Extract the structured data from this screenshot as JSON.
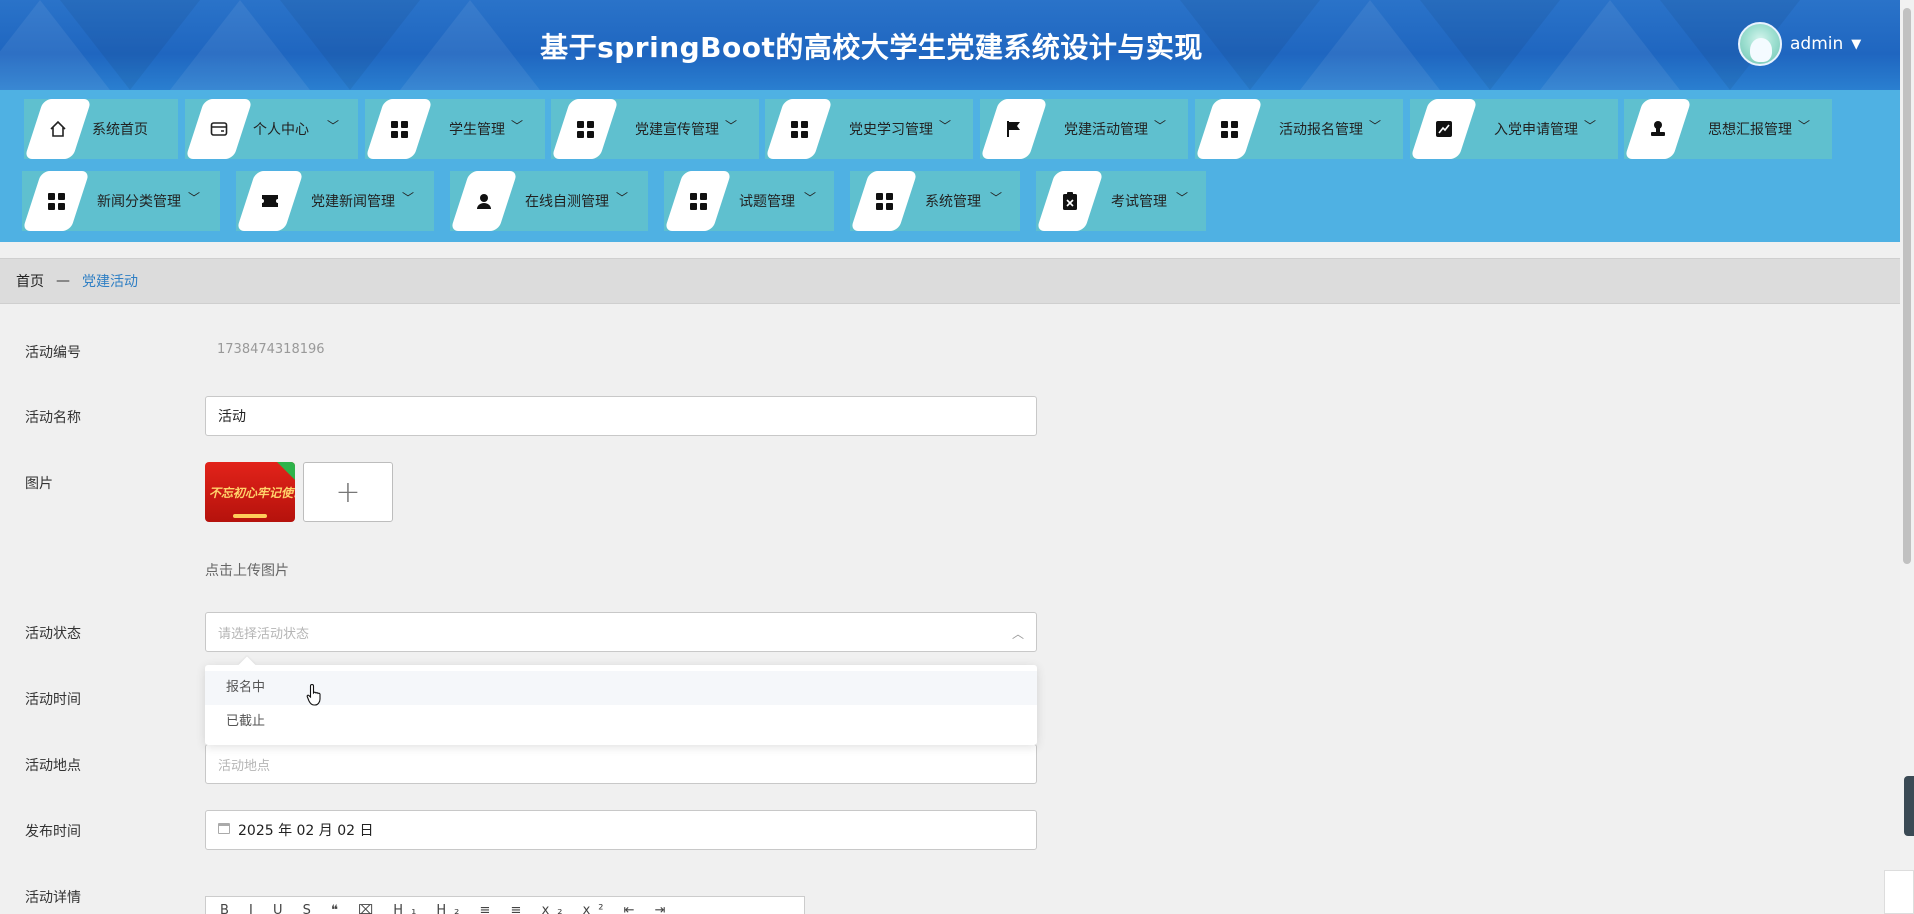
{
  "header": {
    "title": "基于springBoot的高校大学生党建系统设计与实现",
    "user": "admin"
  },
  "nav": {
    "items": [
      {
        "label": "系统首页",
        "icon": "home-icon"
      },
      {
        "label": "个人中心",
        "icon": "card-icon"
      },
      {
        "label": "学生管理",
        "icon": "grid-icon"
      },
      {
        "label": "党建宣传管理",
        "icon": "grid-icon"
      },
      {
        "label": "党史学习管理",
        "icon": "grid-icon"
      },
      {
        "label": "党建活动管理",
        "icon": "flag-icon"
      },
      {
        "label": "活动报名管理",
        "icon": "grid-icon"
      },
      {
        "label": "入党申请管理",
        "icon": "chart-icon"
      },
      {
        "label": "思想汇报管理",
        "icon": "stamp-icon"
      },
      {
        "label": "新闻分类管理",
        "icon": "grid-icon"
      },
      {
        "label": "党建新闻管理",
        "icon": "ticket-icon"
      },
      {
        "label": "在线自测管理",
        "icon": "user-icon"
      },
      {
        "label": "试题管理",
        "icon": "grid-icon"
      },
      {
        "label": "系统管理",
        "icon": "grid-icon"
      },
      {
        "label": "考试管理",
        "icon": "clipboard-icon"
      }
    ]
  },
  "breadcrumb": {
    "home": "首页",
    "separator": "—",
    "current": "党建活动"
  },
  "form": {
    "activity_no": {
      "label": "活动编号",
      "value": "1738474318196"
    },
    "activity_name": {
      "label": "活动名称",
      "value": "活动"
    },
    "image": {
      "label": "图片",
      "thumb_text": "不忘初心牢记使命",
      "upload_symbol": "+",
      "hint": "点击上传图片"
    },
    "status": {
      "label": "活动状态",
      "placeholder": "请选择活动状态",
      "options": [
        "报名中",
        "已截止"
      ]
    },
    "time": {
      "label": "活动时间"
    },
    "location": {
      "label": "活动地点",
      "placeholder": "活动地点"
    },
    "publish_time": {
      "label": "发布时间",
      "value": "2025 年 02 月 02 日"
    },
    "detail": {
      "label": "活动详情",
      "toolbar": "B I U S ❝ ⌧ H₁ H₂ ≡ ≡ x₂ x² ⇤ ⇥"
    }
  }
}
